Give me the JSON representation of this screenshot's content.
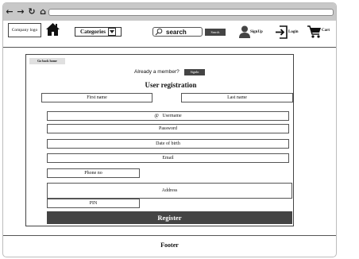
{
  "browser": {
    "back_icon": "arrow-left",
    "forward_icon": "arrow-right",
    "reload_icon": "reload",
    "home_icon": "home"
  },
  "header": {
    "logo_text": "Company logo",
    "home_icon": "home",
    "categories_label": "Categories",
    "search_placeholder": "search",
    "search_button": "Search",
    "signup_label": "SignUp",
    "login_label": "Login",
    "cart_label": "Cart"
  },
  "form": {
    "go_back": "Go back home",
    "member_text": "Already a member?",
    "signin_button": "SignIn",
    "title": "User registration",
    "first_name": "First name",
    "last_name": "Last name",
    "username": "Username",
    "username_prefix": "@",
    "password": "Password",
    "dob": "Date of birth",
    "email": "Email",
    "phone": "Phone no",
    "address": "Address",
    "pin": "PIN",
    "register_button": "Register"
  },
  "footer": {
    "label": "Footer"
  }
}
